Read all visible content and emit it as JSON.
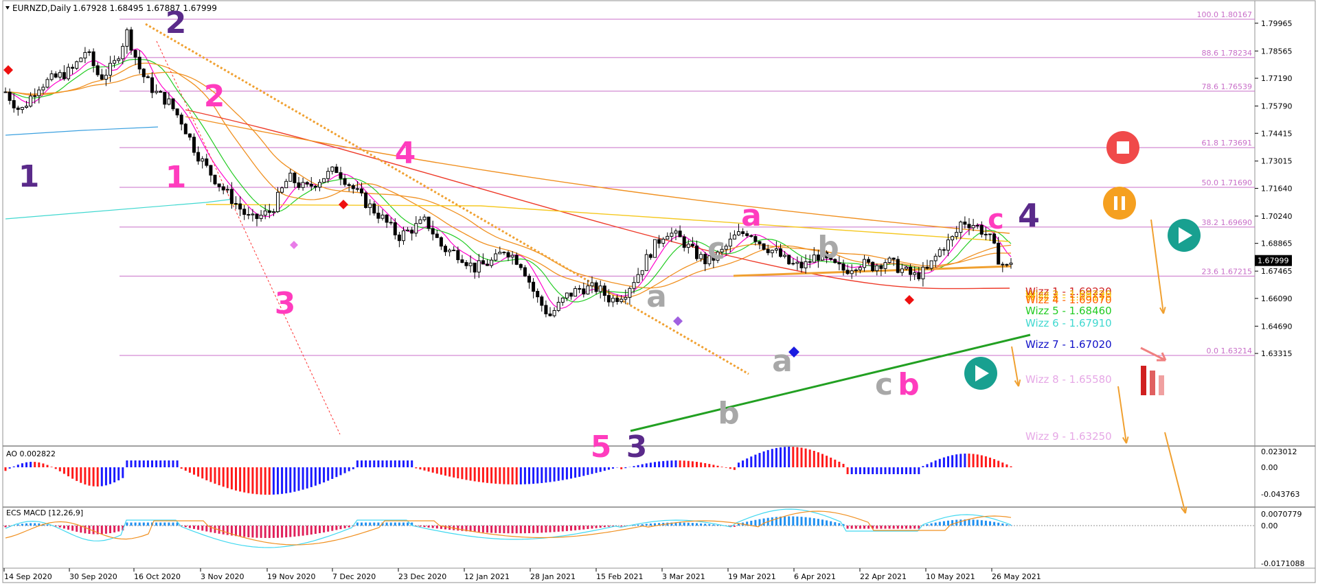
{
  "header": {
    "symbol": "EURNZD,Daily",
    "quote": "1.67928 1.68495 1.67887 1.67999"
  },
  "chart_data": {
    "type": "candlestick",
    "current_price": "1.67999",
    "price_axis": {
      "ticks": [
        "1.79965",
        "1.78565",
        "1.77190",
        "1.75790",
        "1.74415",
        "1.73015",
        "1.71640",
        "1.70240",
        "1.68865",
        "1.67465",
        "1.66090",
        "1.64690",
        "1.63315"
      ],
      "range": [
        1.625,
        1.808
      ]
    },
    "time_axis": [
      "14 Sep 2020",
      "30 Sep 2020",
      "16 Oct 2020",
      "3 Nov 2020",
      "19 Nov 2020",
      "7 Dec 2020",
      "23 Dec 2020",
      "12 Jan 2021",
      "28 Jan 2021",
      "15 Feb 2021",
      "3 Mar 2021",
      "19 Mar 2021",
      "6 Apr 2021",
      "22 Apr 2021",
      "10 May 2021",
      "26 May 2021"
    ],
    "fibonacci": [
      {
        "label": "100.0 1.80167",
        "price": 1.80167
      },
      {
        "label": "88.6 1.78234",
        "price": 1.78234
      },
      {
        "label": "78.6 1.76539",
        "price": 1.76539
      },
      {
        "label": "61.8 1.73691",
        "price": 1.73691
      },
      {
        "label": "50.0 1.71690",
        "price": 1.7169
      },
      {
        "label": "38.2 1.69690",
        "price": 1.6969
      },
      {
        "label": "23.6 1.67215",
        "price": 1.67215
      },
      {
        "label": "0.0 1.63214",
        "price": 1.63214
      }
    ],
    "wizz": [
      {
        "label": "Wizz 1 - 1.69220",
        "color": "#d02020"
      },
      {
        "label": "Wizz 2 - 1.69220",
        "color": "#e8a000"
      },
      {
        "label": "Wizz 3 - 1.69170",
        "color": "#ffd21a"
      },
      {
        "label": "Wizz 4 - 1.69070",
        "color": "#ff6000"
      },
      {
        "label": "Wizz 5 - 1.68460",
        "color": "#22cc22"
      },
      {
        "label": "Wizz 6 - 1.67910",
        "color": "#40d8d0"
      },
      {
        "label": "Wizz 7 - 1.67020",
        "color": "#1010c8"
      },
      {
        "label": "Wizz 8 - 1.65580",
        "color": "#e6a8e6"
      },
      {
        "label": "Wizz 9 - 1.63250",
        "color": "#e6a8e6"
      }
    ],
    "wave_labels": [
      {
        "t": "1",
        "c": "#5a2a8a"
      },
      {
        "t": "2",
        "c": "#5a2a8a"
      },
      {
        "t": "3",
        "c": "#5a2a8a"
      },
      {
        "t": "4",
        "c": "#5a2a8a"
      },
      {
        "t": "1",
        "c": "#ff3cbe"
      },
      {
        "t": "2",
        "c": "#ff3cbe"
      },
      {
        "t": "3",
        "c": "#ff3cbe"
      },
      {
        "t": "4",
        "c": "#ff3cbe"
      },
      {
        "t": "5",
        "c": "#ff3cbe"
      },
      {
        "t": "a",
        "c": "#ff3cbe"
      },
      {
        "t": "b",
        "c": "#ff3cbe"
      },
      {
        "t": "c",
        "c": "#ff3cbe"
      },
      {
        "t": "a",
        "c": "#a8a8a8"
      },
      {
        "t": "b",
        "c": "#a8a8a8"
      },
      {
        "t": "c",
        "c": "#a8a8a8"
      },
      {
        "t": "a",
        "c": "#a8a8a8"
      },
      {
        "t": "b",
        "c": "#a8a8a8"
      },
      {
        "t": "c",
        "c": "#a8a8a8"
      }
    ],
    "ao": {
      "label": "AO 0.002822",
      "ticks": [
        "0.023012",
        "0.00",
        "-0.043763"
      ]
    },
    "macd": {
      "label": "ECS MACD [12,26,9]",
      "ticks": [
        "0.0070779",
        "0.00",
        "-0.0171088"
      ]
    },
    "colors": {
      "up_bar": "#1a1aff",
      "down_bar": "#ff1a1a",
      "fib_line": "#c86ec8",
      "trend_green": "#22a022",
      "trend_orange": "#f0a030"
    }
  }
}
